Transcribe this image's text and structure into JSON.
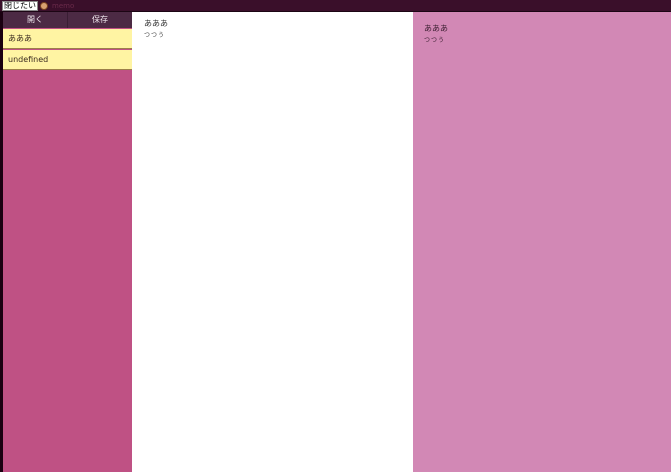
{
  "topbar": {
    "input_value": "閉じたい",
    "favicon": "app-favicon",
    "title": "memo"
  },
  "toolbar": {
    "open_label": "開く",
    "save_label": "保存"
  },
  "notes": [
    {
      "label": "あああ"
    },
    {
      "label": "undefined"
    }
  ],
  "editor": {
    "title": "あああ",
    "body": "つつう"
  },
  "preview": {
    "title": "あああ",
    "body": "つつう"
  },
  "colors": {
    "sidebar": "#bf5184",
    "toolbar": "#4c2a44",
    "note_item": "#fff4a3",
    "editor": "#ffffff",
    "preview": "#d288b5"
  }
}
